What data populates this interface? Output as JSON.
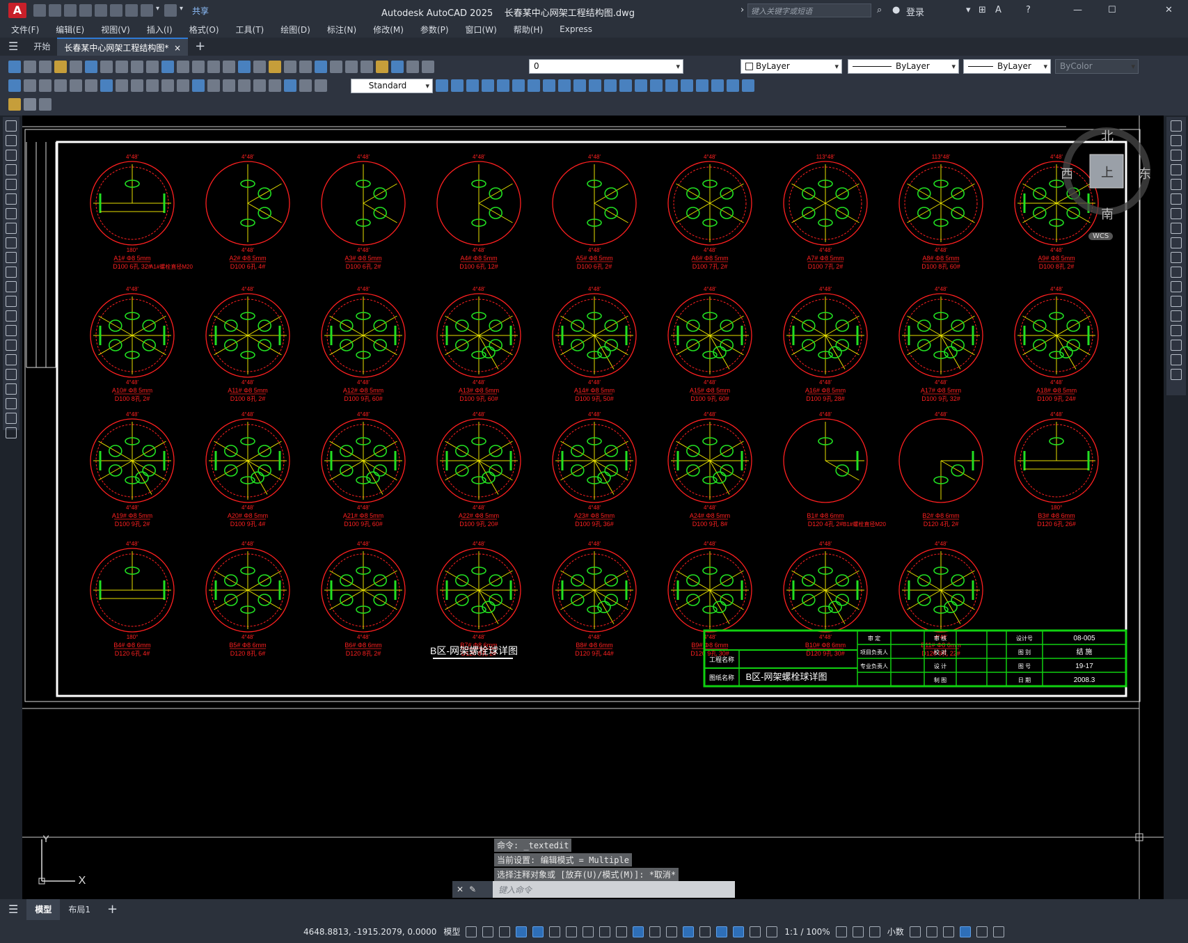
{
  "window": {
    "title": "Autodesk AutoCAD 2025",
    "document": "长春某中心网架工程结构图.dwg",
    "search_placeholder": "键入关键字或短语",
    "login": "登录",
    "share": "共享",
    "app_letter": "A"
  },
  "menu": [
    "文件(F)",
    "编辑(E)",
    "视图(V)",
    "插入(I)",
    "格式(O)",
    "工具(T)",
    "绘图(D)",
    "标注(N)",
    "修改(M)",
    "参数(P)",
    "窗口(W)",
    "帮助(H)",
    "Express"
  ],
  "tabs": {
    "start": "开始",
    "active": "长春某中心网架工程结构图*",
    "close": "×",
    "new": "+"
  },
  "toolbar": {
    "layer": "0",
    "color": "ByLayer",
    "linetype": "ByLayer",
    "lineweight": "ByLayer",
    "plotstyle": "ByColor",
    "textstyle": "Standard"
  },
  "viewcube": {
    "north": "北",
    "south": "南",
    "east": "东",
    "west": "西",
    "top": "上",
    "wcs": "WCS"
  },
  "drawing": {
    "title": "B区-网架螺栓球详图",
    "ball_angles": {
      "top": "4°48'",
      "bottom": "4°48'",
      "top_alt": "113°48'",
      "bottom_alt": "180°"
    },
    "balls": [
      {
        "name": "A1# Φ8 5mm",
        "qty": "D100 6孔 32#",
        "extra": "A1#螺栓直径M20"
      },
      {
        "name": "A2# Φ8 5mm",
        "qty": "D100 6孔 4#"
      },
      {
        "name": "A3# Φ8 5mm",
        "qty": "D100 6孔 2#"
      },
      {
        "name": "A4# Φ8 5mm",
        "qty": "D100 6孔 12#"
      },
      {
        "name": "A5# Φ8 5mm",
        "qty": "D100 6孔 2#"
      },
      {
        "name": "A6# Φ8 5mm",
        "qty": "D100 7孔 2#"
      },
      {
        "name": "A7# Φ8 5mm",
        "qty": "D100 7孔 2#"
      },
      {
        "name": "A8# Φ8 5mm",
        "qty": "D100 8孔 60#"
      },
      {
        "name": "A9# Φ8 5mm",
        "qty": "D100 8孔 2#"
      },
      {
        "name": "A10# Φ8 5mm",
        "qty": "D100 8孔 2#"
      },
      {
        "name": "A11# Φ8 5mm",
        "qty": "D100 8孔 2#"
      },
      {
        "name": "A12# Φ8 5mm",
        "qty": "D100 9孔 60#"
      },
      {
        "name": "A13# Φ8 5mm",
        "qty": "D100 9孔 60#"
      },
      {
        "name": "A14# Φ8 5mm",
        "qty": "D100 9孔 50#"
      },
      {
        "name": "A15# Φ8 5mm",
        "qty": "D100 9孔 60#"
      },
      {
        "name": "A16# Φ8 5mm",
        "qty": "D100 9孔 28#"
      },
      {
        "name": "A17# Φ8 5mm",
        "qty": "D100 9孔 32#"
      },
      {
        "name": "A18# Φ8 5mm",
        "qty": "D100 9孔 24#"
      },
      {
        "name": "A19# Φ8 5mm",
        "qty": "D100 9孔 2#"
      },
      {
        "name": "A20# Φ8 5mm",
        "qty": "D100 9孔 4#"
      },
      {
        "name": "A21# Φ8 5mm",
        "qty": "D100 9孔 60#"
      },
      {
        "name": "A22# Φ8 5mm",
        "qty": "D100 9孔 20#"
      },
      {
        "name": "A23# Φ8 5mm",
        "qty": "D100 9孔 36#"
      },
      {
        "name": "A24# Φ8 5mm",
        "qty": "D100 9孔 8#"
      },
      {
        "name": "B1# Φ8 6mm",
        "qty": "D120 4孔 2#",
        "extra": "B1#螺栓直径M20"
      },
      {
        "name": "B2# Φ8 6mm",
        "qty": "D120 4孔 2#"
      },
      {
        "name": "B3# Φ8 6mm",
        "qty": "D120 6孔 26#"
      },
      {
        "name": "B4# Φ8 6mm",
        "qty": "D120 6孔 4#"
      },
      {
        "name": "B5# Φ8 6mm",
        "qty": "D120 8孔 6#"
      },
      {
        "name": "B6# Φ8 6mm",
        "qty": "D120 8孔 2#"
      },
      {
        "name": "B7# Φ8 6mm",
        "qty": "D120 8孔 2#"
      },
      {
        "name": "B8# Φ8 6mm",
        "qty": "D120 9孔 44#"
      },
      {
        "name": "B9# Φ8 6mm",
        "qty": "D120 9孔 30#"
      },
      {
        "name": "B10# Φ8 6mm",
        "qty": "D120 9孔 30#"
      },
      {
        "name": "B11# Φ8 6mm",
        "qty": "D120 9孔 22#"
      }
    ],
    "ball_styles": [
      "half",
      "sideA",
      "sideA",
      "sideA",
      "sideA",
      "full6",
      "full6b",
      "full6b",
      "full8",
      "full8",
      "full8",
      "full8",
      "full9",
      "full9",
      "full9",
      "full9",
      "full9",
      "full9",
      "full9",
      "full9",
      "full9",
      "full9",
      "full9",
      "full9",
      "quarterA",
      "quarterB",
      "half2",
      "half",
      "full8",
      "full8",
      "full9",
      "full9",
      "full9",
      "full9",
      "full9"
    ],
    "titleblock": {
      "project_label": "工程名称",
      "drawing_label": "图纸名称",
      "drawing_name": "B区-网架螺栓球详图",
      "col1": [
        "审 定",
        "项目负责人",
        "专业负责人"
      ],
      "col2": [
        "审 核",
        "校 对",
        "设 计",
        "制 图"
      ],
      "col3": [
        "设计号",
        "图 别",
        "图 号",
        "日 期"
      ],
      "values": [
        "08-005",
        "结 施",
        "19-17",
        "2008.3"
      ]
    }
  },
  "command": {
    "history": [
      "命令: _textedit",
      "当前设置: 编辑模式 = Multiple",
      "选择注释对象或 [放弃(U)/模式(M)]: *取消*"
    ],
    "placeholder": "键入命令"
  },
  "layouts": {
    "model": "模型",
    "layout1": "布局1",
    "add": "+"
  },
  "status": {
    "coords": "4648.8813, -1915.2079, 0.0000",
    "model": "模型",
    "scale": "1:1 / 100%",
    "units": "小数"
  },
  "colors": {
    "frame": "#ffffff",
    "ring": "#ff2020",
    "bolt": "#22e022",
    "spoke": "#e8e000",
    "title_green": "#10d010"
  }
}
